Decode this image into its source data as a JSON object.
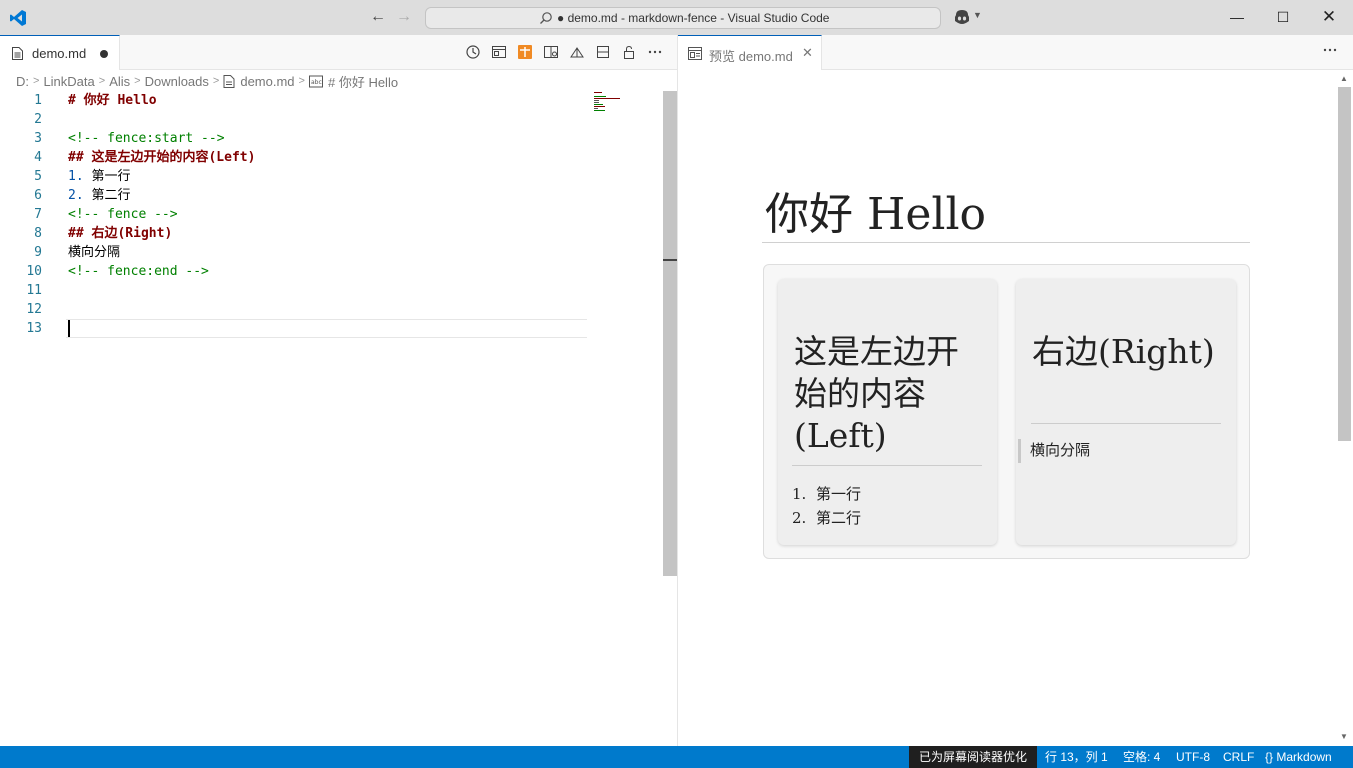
{
  "window": {
    "title": "● demo.md - markdown-fence - Visual Studio Code"
  },
  "left_group": {
    "tab": {
      "label": "demo.md"
    }
  },
  "breadcrumb": {
    "items": [
      "D:",
      "LinkData",
      "Alis",
      "Downloads",
      "demo.md",
      "# 你好 Hello"
    ]
  },
  "editor": {
    "lines": [
      {
        "num": "1",
        "parts": [
          {
            "text": "# 你好 Hello",
            "kind": "heading"
          }
        ]
      },
      {
        "num": "2",
        "parts": []
      },
      {
        "num": "3",
        "parts": [
          {
            "text": "<!-- fence:start -->",
            "kind": "comment"
          }
        ]
      },
      {
        "num": "4",
        "parts": [
          {
            "text": "## 这是左边开始的内容(Left)",
            "kind": "heading"
          }
        ]
      },
      {
        "num": "5",
        "parts": [
          {
            "text": "1.",
            "kind": "number"
          },
          {
            "text": " 第一行",
            "kind": "plain"
          }
        ]
      },
      {
        "num": "6",
        "parts": [
          {
            "text": "2.",
            "kind": "number"
          },
          {
            "text": " 第二行",
            "kind": "plain"
          }
        ]
      },
      {
        "num": "7",
        "parts": [
          {
            "text": "<!-- fence -->",
            "kind": "comment"
          }
        ]
      },
      {
        "num": "8",
        "parts": [
          {
            "text": "## 右边(Right)",
            "kind": "heading"
          }
        ]
      },
      {
        "num": "9",
        "parts": [
          {
            "text": "横向分隔",
            "kind": "plain"
          }
        ]
      },
      {
        "num": "10",
        "parts": [
          {
            "text": "<!-- fence:end -->",
            "kind": "comment"
          }
        ]
      },
      {
        "num": "11",
        "parts": []
      },
      {
        "num": "12",
        "parts": []
      },
      {
        "num": "13",
        "parts": []
      }
    ],
    "current_line": 13
  },
  "right_group": {
    "tab": {
      "label": "预览 demo.md",
      "close_glyph": "✕"
    }
  },
  "preview": {
    "h1": "你好 Hello",
    "left_card": {
      "heading": "这是左边开始的内容(Left)",
      "list": [
        {
          "num": "1.",
          "text": "第一行"
        },
        {
          "num": "2.",
          "text": "第二行"
        }
      ]
    },
    "right_card": {
      "heading": "右边(Right)",
      "quote": "横向分隔"
    }
  },
  "statusbar": {
    "screen_reader": "已为屏幕阅读器优化",
    "position": "行 13，列 1",
    "indent": "空格: 4",
    "encoding": "UTF-8",
    "eol": "CRLF",
    "language_icon": "{}",
    "language": "Markdown"
  },
  "colors": {
    "titlebar": "#dddddd",
    "statusbar": "#007acc",
    "accent": "#005fb8",
    "md_heading": "#800000",
    "md_comment": "#008000",
    "md_number": "#0451a5",
    "line_number": "#237893",
    "active_action_icon": "#f08a24"
  },
  "icons": {
    "app": "vscode-logo-icon",
    "back": "arrow-left-icon",
    "forward": "arrow-right-icon",
    "search": "search-icon",
    "copilot": "copilot-icon",
    "file": "markdown-file-icon",
    "preview": "preview-icon",
    "symbol": "string-symbol-icon"
  }
}
